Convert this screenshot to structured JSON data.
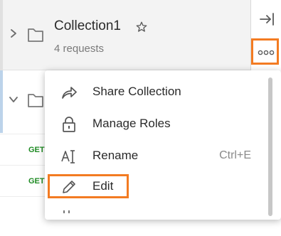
{
  "collection": {
    "name": "Collection1",
    "request_count_label": "4 requests"
  },
  "requests": [
    {
      "method": "GET"
    },
    {
      "method": "GET"
    }
  ],
  "context_menu": {
    "items": [
      {
        "label": "Share Collection",
        "shortcut": ""
      },
      {
        "label": "Manage Roles",
        "shortcut": ""
      },
      {
        "label": "Rename",
        "shortcut": "Ctrl+E"
      },
      {
        "label": "Edit",
        "shortcut": ""
      }
    ]
  },
  "colors": {
    "highlight": "#f37b22",
    "method_get": "#1f8b24"
  },
  "icons": {
    "collapse": "collapse-sidebar-icon",
    "more": "more-actions-icon",
    "share": "share-arrow-icon",
    "roles": "lock-icon",
    "rename": "rename-text-icon",
    "edit": "pencil-icon"
  }
}
